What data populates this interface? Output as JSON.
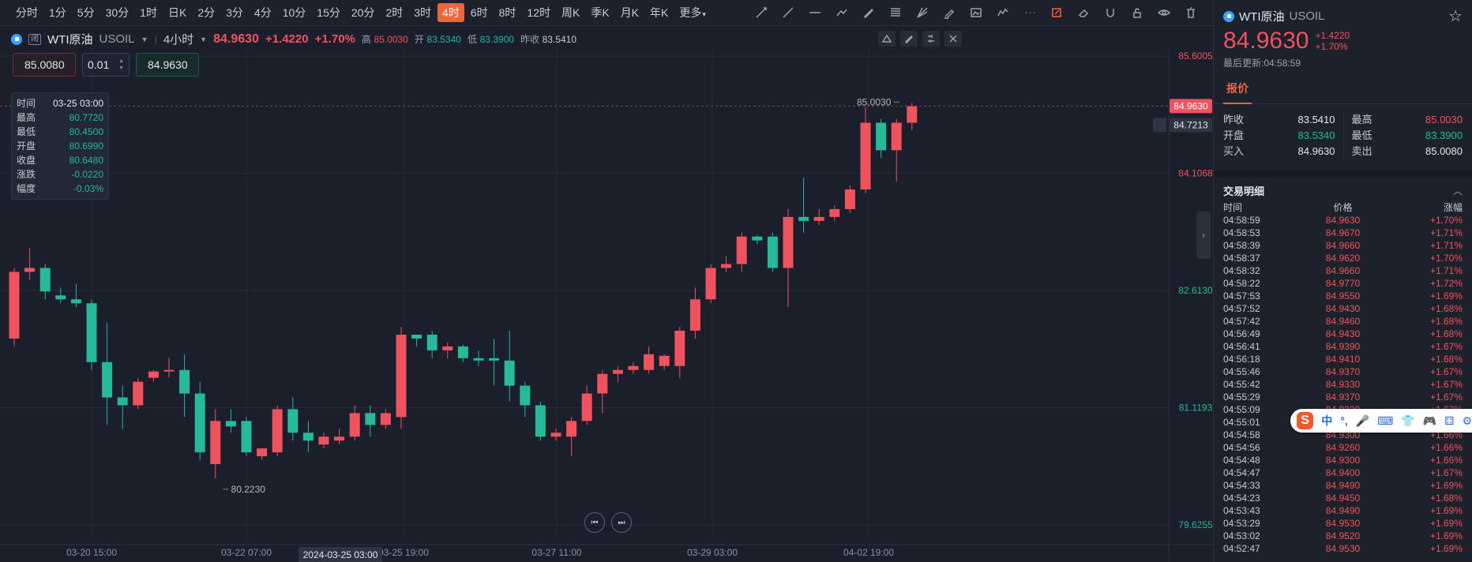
{
  "toolbar": {
    "periods": [
      "分时",
      "1分",
      "5分",
      "30分",
      "1时",
      "日K",
      "2分",
      "3分",
      "4分",
      "10分",
      "15分",
      "20分",
      "2时",
      "3时",
      "4时",
      "6时",
      "8时",
      "12时",
      "周K",
      "季K",
      "月K",
      "年K",
      "更多"
    ],
    "active_period": "4时",
    "tools": [
      "ray-icon",
      "trend-line-icon",
      "horizontal-line-icon",
      "segment-icon",
      "pen-icon",
      "fibonacci-icon",
      "gann-fan-icon",
      "highlighter-icon",
      "image-icon",
      "path-icon",
      "more-dots-icon",
      "note-icon",
      "eraser-icon",
      "magnet-icon",
      "lock-icon",
      "eye-icon",
      "trash-icon"
    ]
  },
  "legend": {
    "name": "WTI原油",
    "code": "USOIL",
    "badge": "闭",
    "period": "4小时",
    "price": "84.9630",
    "change": "+1.4220",
    "change_pct": "+1.70%",
    "high_label": "高",
    "high": "85.0030",
    "open_label": "开",
    "open": "83.5340",
    "low_label": "低",
    "low": "83.3900",
    "prev_label": "昨收",
    "prev": "83.5410"
  },
  "order": {
    "sell": "85.0080",
    "qty": "0.01",
    "buy": "84.9630"
  },
  "ohlc_box": [
    {
      "label": "时间",
      "value": "03-25 03:00"
    },
    {
      "label": "最高",
      "value": "80.7720"
    },
    {
      "label": "最低",
      "value": "80.4500"
    },
    {
      "label": "开盘",
      "value": "80.6990"
    },
    {
      "label": "收盘",
      "value": "80.6480"
    },
    {
      "label": "涨跌",
      "value": "-0.0220"
    },
    {
      "label": "幅度",
      "value": "-0.03%"
    }
  ],
  "colors": {
    "up": "#f0535d",
    "down": "#26b99a",
    "accent": "#f0663c",
    "bg": "#1a1f2b"
  },
  "chart_data": {
    "type": "candlestick",
    "y_ticks": [
      "85.6005",
      "84.1068",
      "82.6130",
      "81.1193",
      "79.6255"
    ],
    "y_tick_values": [
      85.6005,
      84.1068,
      82.613,
      81.1193,
      79.6255
    ],
    "x_ticks": [
      "03-20 15:00",
      "03-22 07:00",
      "03-25 19:00",
      "03-27 11:00",
      "03-29 03:00",
      "04-02 19:00"
    ],
    "crosshair_time": "2024-03-25 03:00",
    "last_price_label": "84.9630",
    "alert_price_label": "84.7213",
    "high_marker": "85.0030",
    "low_marker": "80.2230",
    "candles": [
      {
        "o": 82.0,
        "h": 82.9,
        "l": 81.9,
        "c": 82.85
      },
      {
        "o": 82.85,
        "h": 83.15,
        "l": 82.75,
        "c": 82.9
      },
      {
        "o": 82.9,
        "h": 82.95,
        "l": 82.5,
        "c": 82.6
      },
      {
        "o": 82.55,
        "h": 82.65,
        "l": 82.45,
        "c": 82.5
      },
      {
        "o": 82.5,
        "h": 82.7,
        "l": 82.4,
        "c": 82.45
      },
      {
        "o": 82.45,
        "h": 82.5,
        "l": 81.6,
        "c": 81.7
      },
      {
        "o": 81.7,
        "h": 82.2,
        "l": 80.9,
        "c": 81.25
      },
      {
        "o": 81.25,
        "h": 81.4,
        "l": 80.85,
        "c": 81.15
      },
      {
        "o": 81.15,
        "h": 81.5,
        "l": 81.1,
        "c": 81.45
      },
      {
        "o": 81.5,
        "h": 81.6,
        "l": 81.45,
        "c": 81.58
      },
      {
        "o": 81.58,
        "h": 81.75,
        "l": 81.5,
        "c": 81.6
      },
      {
        "o": 81.6,
        "h": 81.8,
        "l": 81.0,
        "c": 81.3
      },
      {
        "o": 81.3,
        "h": 81.45,
        "l": 80.45,
        "c": 80.55
      },
      {
        "o": 80.4,
        "h": 81.1,
        "l": 80.22,
        "c": 80.95
      },
      {
        "o": 80.95,
        "h": 81.1,
        "l": 80.8,
        "c": 80.88
      },
      {
        "o": 80.95,
        "h": 81.0,
        "l": 80.5,
        "c": 80.55
      },
      {
        "o": 80.5,
        "h": 80.6,
        "l": 80.45,
        "c": 80.6
      },
      {
        "o": 80.55,
        "h": 81.15,
        "l": 80.5,
        "c": 81.1
      },
      {
        "o": 81.1,
        "h": 81.25,
        "l": 80.7,
        "c": 80.8
      },
      {
        "o": 80.8,
        "h": 80.95,
        "l": 80.55,
        "c": 80.7
      },
      {
        "o": 80.65,
        "h": 80.8,
        "l": 80.6,
        "c": 80.75
      },
      {
        "o": 80.7,
        "h": 80.85,
        "l": 80.65,
        "c": 80.75
      },
      {
        "o": 80.75,
        "h": 81.15,
        "l": 80.7,
        "c": 81.05
      },
      {
        "o": 81.05,
        "h": 81.15,
        "l": 80.75,
        "c": 80.9
      },
      {
        "o": 80.9,
        "h": 81.1,
        "l": 80.85,
        "c": 81.05
      },
      {
        "o": 81.0,
        "h": 82.15,
        "l": 80.85,
        "c": 82.05
      },
      {
        "o": 82.05,
        "h": 82.05,
        "l": 81.9,
        "c": 82.0
      },
      {
        "o": 82.05,
        "h": 82.1,
        "l": 81.75,
        "c": 81.85
      },
      {
        "o": 81.85,
        "h": 81.95,
        "l": 81.75,
        "c": 81.9
      },
      {
        "o": 81.9,
        "h": 81.92,
        "l": 81.7,
        "c": 81.75
      },
      {
        "o": 81.75,
        "h": 81.85,
        "l": 81.65,
        "c": 81.72
      },
      {
        "o": 81.75,
        "h": 82.0,
        "l": 81.4,
        "c": 81.72
      },
      {
        "o": 81.72,
        "h": 82.1,
        "l": 81.2,
        "c": 81.4
      },
      {
        "o": 81.4,
        "h": 81.45,
        "l": 81.0,
        "c": 81.15
      },
      {
        "o": 81.15,
        "h": 81.2,
        "l": 80.7,
        "c": 80.75
      },
      {
        "o": 80.75,
        "h": 80.85,
        "l": 80.7,
        "c": 80.8
      },
      {
        "o": 80.75,
        "h": 81.0,
        "l": 80.5,
        "c": 80.95
      },
      {
        "o": 80.95,
        "h": 81.4,
        "l": 80.9,
        "c": 81.3
      },
      {
        "o": 81.3,
        "h": 81.6,
        "l": 81.05,
        "c": 81.55
      },
      {
        "o": 81.55,
        "h": 81.65,
        "l": 81.45,
        "c": 81.6
      },
      {
        "o": 81.6,
        "h": 81.7,
        "l": 81.55,
        "c": 81.65
      },
      {
        "o": 81.6,
        "h": 81.9,
        "l": 81.55,
        "c": 81.8
      },
      {
        "o": 81.65,
        "h": 81.8,
        "l": 81.6,
        "c": 81.78
      },
      {
        "o": 81.65,
        "h": 82.15,
        "l": 81.5,
        "c": 82.1
      },
      {
        "o": 82.1,
        "h": 82.65,
        "l": 82.0,
        "c": 82.5
      },
      {
        "o": 82.5,
        "h": 82.95,
        "l": 82.45,
        "c": 82.9
      },
      {
        "o": 82.9,
        "h": 83.05,
        "l": 82.85,
        "c": 82.95
      },
      {
        "o": 82.95,
        "h": 83.35,
        "l": 82.85,
        "c": 83.3
      },
      {
        "o": 83.3,
        "h": 83.32,
        "l": 83.2,
        "c": 83.25
      },
      {
        "o": 83.3,
        "h": 83.35,
        "l": 82.85,
        "c": 82.9
      },
      {
        "o": 82.9,
        "h": 83.65,
        "l": 82.4,
        "c": 83.55
      },
      {
        "o": 83.55,
        "h": 84.05,
        "l": 83.35,
        "c": 83.5
      },
      {
        "o": 83.5,
        "h": 83.65,
        "l": 83.45,
        "c": 83.55
      },
      {
        "o": 83.55,
        "h": 83.7,
        "l": 83.5,
        "c": 83.65
      },
      {
        "o": 83.65,
        "h": 83.95,
        "l": 83.6,
        "c": 83.9
      },
      {
        "o": 83.9,
        "h": 84.95,
        "l": 83.85,
        "c": 84.75
      },
      {
        "o": 84.75,
        "h": 84.8,
        "l": 84.3,
        "c": 84.4
      },
      {
        "o": 84.4,
        "h": 84.8,
        "l": 84.0,
        "c": 84.75
      },
      {
        "o": 84.75,
        "h": 85.0,
        "l": 84.65,
        "c": 84.96
      }
    ]
  },
  "panel": {
    "name": "WTI原油",
    "code": "USOIL",
    "price": "84.9630",
    "change": "+1.4220",
    "change_pct": "+1.70%",
    "updated": "最后更新:04:58:59",
    "tab": "报价",
    "quote": [
      {
        "label": "昨收",
        "value": "83.5410",
        "color": "w"
      },
      {
        "label": "最高",
        "value": "85.0030",
        "color": "r"
      },
      {
        "label": "开盘",
        "value": "83.5340",
        "color": "g"
      },
      {
        "label": "最低",
        "value": "83.3900",
        "color": "g"
      },
      {
        "label": "买入",
        "value": "84.9630",
        "color": "w"
      },
      {
        "label": "卖出",
        "value": "85.0080",
        "color": "w"
      }
    ],
    "trades_title": "交易明细",
    "trades_cols": [
      "时间",
      "价格",
      "涨幅"
    ],
    "trades": [
      {
        "t": "04:58:59",
        "p": "84.9630",
        "c": "+1.70%"
      },
      {
        "t": "04:58:53",
        "p": "84.9670",
        "c": "+1.71%"
      },
      {
        "t": "04:58:39",
        "p": "84.9660",
        "c": "+1.71%"
      },
      {
        "t": "04:58:37",
        "p": "84.9620",
        "c": "+1.70%"
      },
      {
        "t": "04:58:32",
        "p": "84.9660",
        "c": "+1.71%"
      },
      {
        "t": "04:58:22",
        "p": "84.9770",
        "c": "+1.72%"
      },
      {
        "t": "04:57:53",
        "p": "84.9550",
        "c": "+1.69%"
      },
      {
        "t": "04:57:52",
        "p": "84.9430",
        "c": "+1.68%"
      },
      {
        "t": "04:57:42",
        "p": "84.9460",
        "c": "+1.68%"
      },
      {
        "t": "04:56:49",
        "p": "84.9430",
        "c": "+1.68%"
      },
      {
        "t": "04:56:41",
        "p": "84.9390",
        "c": "+1.67%"
      },
      {
        "t": "04:56:18",
        "p": "84.9410",
        "c": "+1.68%"
      },
      {
        "t": "04:55:46",
        "p": "84.9370",
        "c": "+1.67%"
      },
      {
        "t": "04:55:42",
        "p": "84.9330",
        "c": "+1.67%"
      },
      {
        "t": "04:55:29",
        "p": "84.9370",
        "c": "+1.67%"
      },
      {
        "t": "04:55:09",
        "p": "84.9330",
        "c": "+1.67%"
      },
      {
        "t": "04:55:01",
        "p": "84.9330",
        "c": "+1.67%"
      },
      {
        "t": "04:54:58",
        "p": "84.9300",
        "c": "+1.66%"
      },
      {
        "t": "04:54:56",
        "p": "84.9260",
        "c": "+1.66%"
      },
      {
        "t": "04:54:48",
        "p": "84.9300",
        "c": "+1.66%"
      },
      {
        "t": "04:54:47",
        "p": "84.9400",
        "c": "+1.67%"
      },
      {
        "t": "04:54:33",
        "p": "84.9490",
        "c": "+1.69%"
      },
      {
        "t": "04:54:23",
        "p": "84.9450",
        "c": "+1.68%"
      },
      {
        "t": "04:53:43",
        "p": "84.9490",
        "c": "+1.69%"
      },
      {
        "t": "04:53:29",
        "p": "84.9530",
        "c": "+1.69%"
      },
      {
        "t": "04:53:02",
        "p": "84.9520",
        "c": "+1.69%"
      },
      {
        "t": "04:52:47",
        "p": "84.9530",
        "c": "+1.69%"
      }
    ]
  },
  "ime": {
    "logo": "S",
    "items": [
      "中",
      "°,",
      "🎤",
      "⌨",
      "👕",
      "🎮",
      "⚃",
      "⚙"
    ]
  }
}
